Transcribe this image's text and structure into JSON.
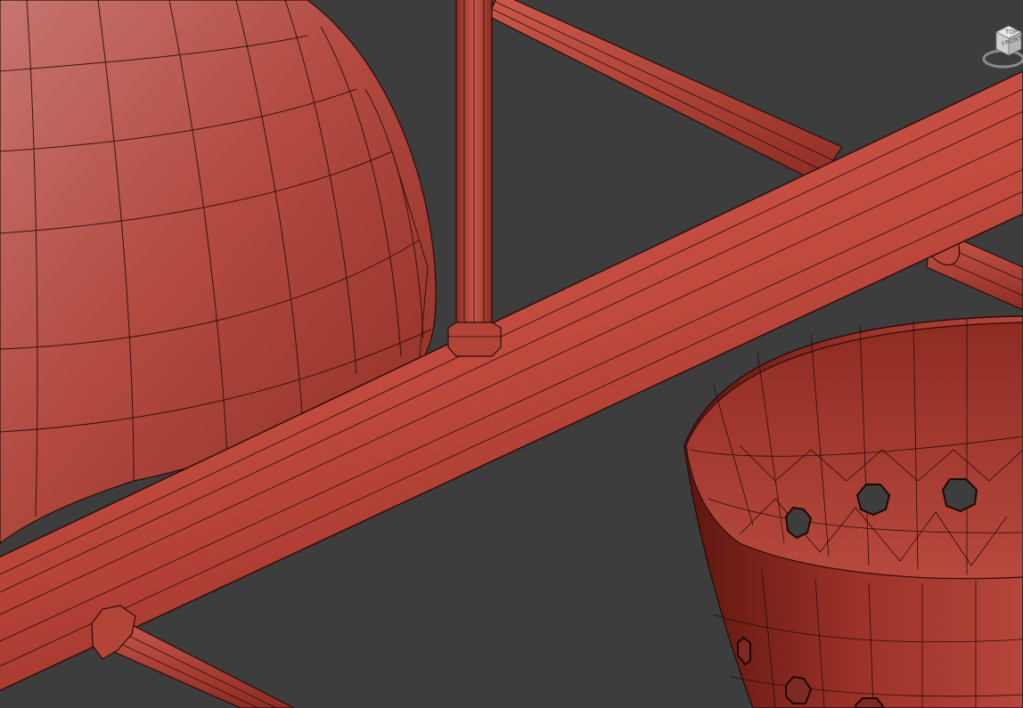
{
  "viewport": {
    "background": "#3d3d3d",
    "object_color": "#b8453a",
    "wire_color": "#2a0c08"
  },
  "viewcube": {
    "top_face_label": "TOP",
    "front_face_label": "FRONT",
    "icon": "viewcube-icon"
  }
}
